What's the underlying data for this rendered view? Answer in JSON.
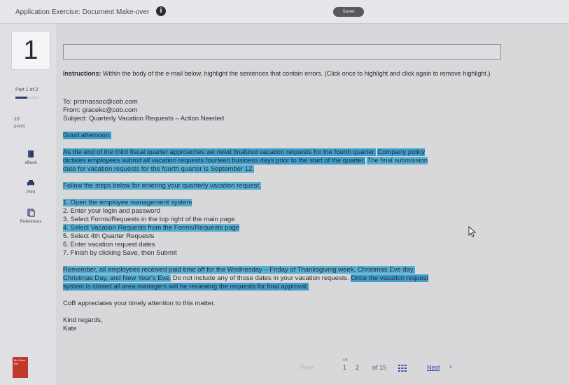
{
  "header": {
    "title": "Application Exercise: Document Make-over",
    "saved_badge": "Saved"
  },
  "sidebar": {
    "question_number": "1",
    "part_label": "Part 1 of 2",
    "part_progress": 0.5,
    "points_value": "10",
    "points_label": "points",
    "tools": [
      {
        "label": "eBook",
        "icon": "book-icon"
      },
      {
        "label": "Print",
        "icon": "print-icon"
      },
      {
        "label": "References",
        "icon": "references-icon"
      }
    ],
    "brand_text": "Mc Graw Hill"
  },
  "answer_box_value": "",
  "instructions": {
    "bold_prefix": "Instructions:",
    "text": "Within the body of the e-mail below, highlight the sentences that contain errors. (Click once to highlight and click again to remove highlight.)"
  },
  "email": {
    "to": "To: prcmassoc@cob.com",
    "from": "From: gracekc@cob.com",
    "subject": "Subject: Quarterly Vacation Requests – Action Needed",
    "greeting": "Good afternoon:",
    "p1_s1": "As the end of the third fiscal quarter approaches we need finalized vacation requests for the fourth quarter.",
    "p1_s2": "Company policy dictates employees submit all vacation requests fourteen business days prior to the start of the quarter.",
    "p1_s3": "The final submission date for vacation requests for the fourth quarter is September 12.",
    "p2": "Follow the steps below for entering your quarterly vacation request.",
    "steps": [
      "1. Open the employee management system",
      "2. Enter your login and password",
      "3. Select Forms/Requests in the top right of the main page",
      "4. Select Vacation Requests from the Forms/Requests page",
      "5. Select 4th Quarter Requests",
      "6. Enter vacation request dates",
      "7. Finish by clicking Save, then Submit"
    ],
    "p3_s1": "Remember, all employees received paid time off for the Wednesday – Friday of Thanksgiving week, Christmas Eve day, Christmas Day, and New Year's Eve.",
    "p3_s2": "Do not include any of those dates in your vacation requests.",
    "p3_s3": "Once the vacation request system is closed all area managers will be reviewing the requests for final approval.",
    "p4": "CoB appreciates your timely attention to this matter.",
    "closing": "Kind regards,",
    "signature": "Kate"
  },
  "footer": {
    "prev": "Prev",
    "page_a": "1",
    "page_b": "2",
    "of_total": "of 15",
    "next": "Next",
    "current_page_marker": "c/3"
  },
  "colors": {
    "highlight": "#3fa0ce",
    "highlight_alt": "#57b0d4",
    "next_link": "#2f4fa8"
  }
}
